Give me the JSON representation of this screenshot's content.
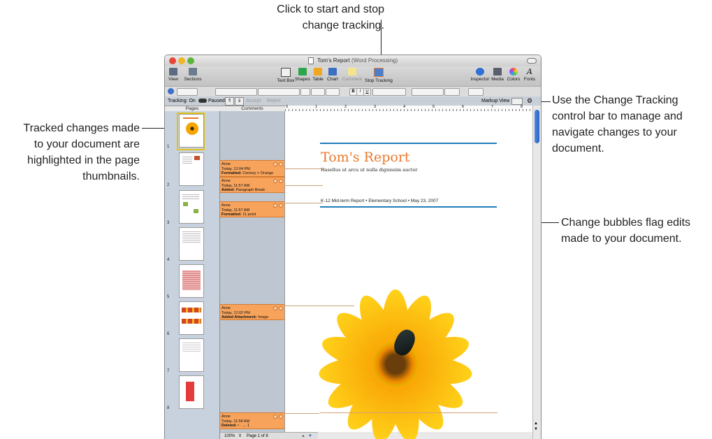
{
  "callouts": {
    "top": [
      "Click to start and stop",
      "change tracking."
    ],
    "right_top": [
      "Use the Change Tracking",
      "control bar to manage and",
      "navigate changes to your",
      "document."
    ],
    "left": [
      "Tracked changes made",
      "to your document are",
      "highlighted in the page",
      "thumbnails."
    ],
    "right_bottom": [
      "Change bubbles flag edits",
      "made to your document."
    ]
  },
  "window": {
    "title": "Tom's Report",
    "subtitle": "(Word Processing)"
  },
  "toolbar": {
    "view": "View",
    "sections": "Sections",
    "text_box": "Text Box",
    "shapes": "Shapes",
    "table": "Table",
    "chart": "Chart",
    "comment": "Comment",
    "stop_tracking": "Stop Tracking",
    "inspector": "Inspector",
    "media": "Media",
    "colors": "Colors",
    "fonts": "Fonts"
  },
  "format_bar": {
    "bold": "B",
    "italic": "I",
    "underline": "U"
  },
  "tracking_bar": {
    "tracking_label": "Tracking: On",
    "paused_label": "Paused",
    "accept": "Accept",
    "reject": "Reject",
    "markup_view": "Markup View"
  },
  "columns": {
    "pages": "Pages",
    "comments": "Comments"
  },
  "ruler_numbers": [
    "0",
    "1",
    "2",
    "3",
    "4",
    "5",
    "6",
    "7",
    "8"
  ],
  "pages": [
    {
      "number": "1"
    },
    {
      "number": "2"
    },
    {
      "number": "3"
    },
    {
      "number": "4"
    },
    {
      "number": "5"
    },
    {
      "number": "6"
    },
    {
      "number": "7"
    },
    {
      "number": "8"
    }
  ],
  "bubbles": [
    {
      "author": "Anne",
      "time": "Today, 12:04 PM",
      "action": "Formatted:",
      "detail": "Century + Orange"
    },
    {
      "author": "Anne",
      "time": "Today, 11:57 AM",
      "action": "Added:",
      "detail": "Paragraph Break"
    },
    {
      "author": "Anne",
      "time": "Today, 11:57 AM",
      "action": "Formatted:",
      "detail": "11 point"
    },
    {
      "author": "Anne",
      "time": "Today, 12:02 PM",
      "action": "Added Attachment:",
      "detail": "Image"
    },
    {
      "author": "Anne",
      "time": "Today, 11:58 AM",
      "action": "Deleted:",
      "detail": "• · → 1"
    }
  ],
  "document": {
    "title": "Tom's Report",
    "subtitle": "Hasellus ut arcu ut nulla dignissim auctor",
    "info_line": "K-12 Mid-term Report • Elementary School • May 23, 2007"
  },
  "status": {
    "zoom": "100%",
    "page_indicator": "Page 1 of 8"
  },
  "colors": {
    "accent_blue": "#1f7db8",
    "title_orange": "#e8792b",
    "bubble_orange": "#f7a35c"
  }
}
